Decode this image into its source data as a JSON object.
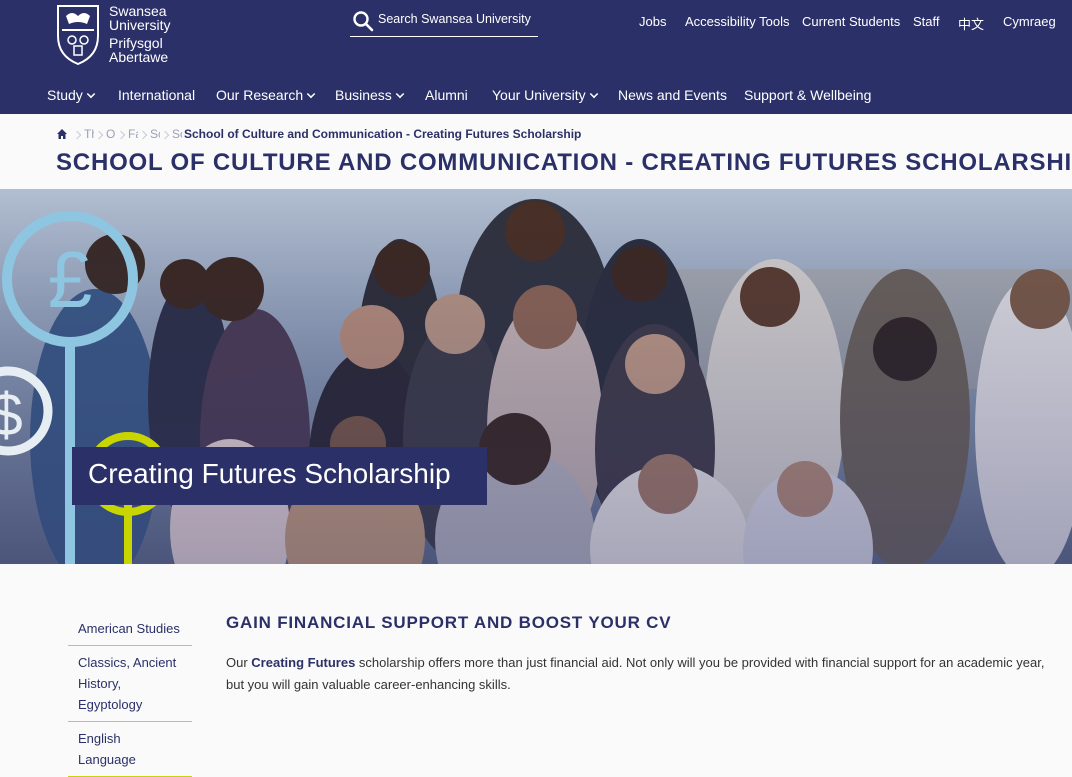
{
  "header": {
    "logo": {
      "line1": "Swansea",
      "line2": "University",
      "line3": "Prifysgol",
      "line4": "Abertawe"
    },
    "search": {
      "placeholder": "Search Swansea University"
    },
    "utility_links": [
      "Jobs",
      "Accessibility Tools",
      "Current Students",
      "Staff",
      "中文",
      "Cymraeg"
    ],
    "main_nav": [
      {
        "label": "Study",
        "dropdown": true
      },
      {
        "label": "International",
        "dropdown": false
      },
      {
        "label": "Our Research",
        "dropdown": true
      },
      {
        "label": "Business",
        "dropdown": true
      },
      {
        "label": "Alumni",
        "dropdown": false
      },
      {
        "label": "Your University",
        "dropdown": true
      },
      {
        "label": "News and Events",
        "dropdown": false
      },
      {
        "label": "Support & Wellbeing",
        "dropdown": false
      }
    ]
  },
  "breadcrumb": {
    "home_icon": "home-icon",
    "collapsed": [
      "Th",
      "Ou",
      "Fa",
      "Sc",
      "Sc"
    ],
    "current": "School of Culture and Communication - Creating Futures Scholarship"
  },
  "page_title": "SCHOOL OF CULTURE AND COMMUNICATION - CREATING FUTURES SCHOLARSHIP",
  "hero": {
    "banner_text": "Creating Futures Scholarship"
  },
  "sidebar": {
    "items": [
      "American Studies",
      "Classics, Ancient History, Egyptology",
      "English Language"
    ]
  },
  "content": {
    "heading": "GAIN FINANCIAL SUPPORT AND BOOST YOUR CV",
    "para_pre": "Our ",
    "para_bold": "Creating Futures",
    "para_post": " scholarship offers more than just financial aid.  Not only will you be provided with financial support for an academic year, but you will gain valuable career-enhancing skills."
  },
  "colors": {
    "navy": "#2b3068",
    "accent_lime": "#c9d500",
    "accent_blue": "#8ec5e0"
  }
}
